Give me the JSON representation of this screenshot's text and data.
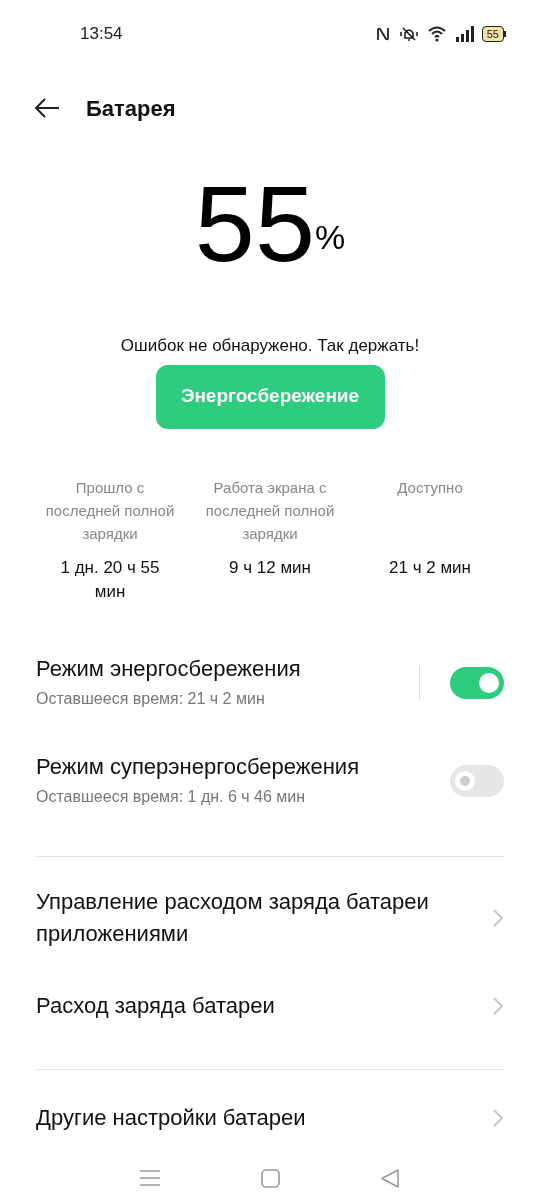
{
  "status_bar": {
    "time": "13:54",
    "battery": "55"
  },
  "header": {
    "title": "Батарея"
  },
  "level": {
    "value": "55",
    "unit": "%"
  },
  "message": "Ошибок не обнаружено. Так держать!",
  "action_button": "Энергосбережение",
  "stats": [
    {
      "label": "Прошло с последней полной зарядки",
      "value": "1 дн. 20 ч 55 мин"
    },
    {
      "label": "Работа экрана с последней полной зарядки",
      "value": "9 ч 12 мин"
    },
    {
      "label": "Доступно",
      "value": "21 ч 2 мин"
    }
  ],
  "modes": [
    {
      "title": "Режим энергосбережения",
      "subtitle": "Оставшееся время:  21 ч 2 мин",
      "on": true,
      "divider": true
    },
    {
      "title": "Режим суперэнергосбережения",
      "subtitle": "Оставшееся время:  1 дн. 6 ч 46 мин",
      "on": false,
      "divider": false
    }
  ],
  "links": [
    {
      "label": "Управление расходом заряда батареи приложениями"
    },
    {
      "label": "Расход заряда батареи"
    }
  ],
  "links_2": [
    {
      "label": "Другие настройки батареи"
    }
  ]
}
